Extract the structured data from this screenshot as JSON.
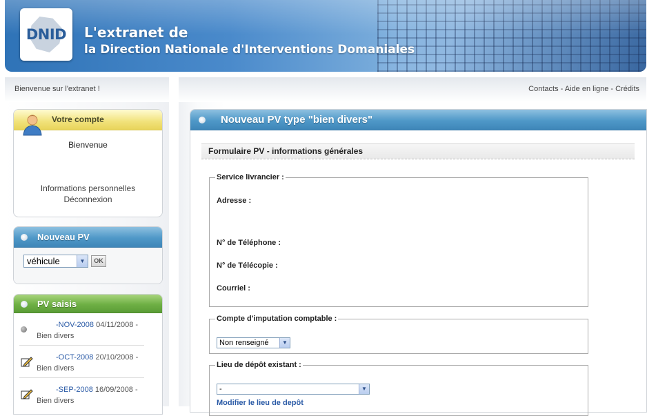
{
  "header": {
    "logo_text": "DNID",
    "title_line1": "L'extranet de",
    "title_line2": "la Direction Nationale d'Interventions Domaniales"
  },
  "topbar": {
    "welcome": "Bienvenue sur l'extranet !",
    "links": [
      "Contacts",
      "Aide en ligne",
      "Crédits"
    ],
    "separator": " - "
  },
  "account": {
    "title": "Votre compte",
    "welcome": "Bienvenue",
    "links": [
      "Informations personnelles",
      "Déconnexion"
    ]
  },
  "new_pv": {
    "title": "Nouveau PV",
    "select_value": "véhicule",
    "ok_label": "OK"
  },
  "pv_saisis": {
    "title": "PV saisis",
    "items": [
      {
        "ref": "-NOV-2008",
        "date": "04/11/2008 -",
        "type": "Bien divers",
        "icon": "gray-dot-icon"
      },
      {
        "ref": "-OCT-2008",
        "date": "20/10/2008 -",
        "type": "Bien divers",
        "icon": "edit-icon"
      },
      {
        "ref": "-SEP-2008",
        "date": "16/09/2008 -",
        "type": "Bien divers",
        "icon": "edit-icon"
      }
    ]
  },
  "main": {
    "title": "Nouveau PV type \"bien divers\"",
    "form_title": "Formulaire PV - informations générales",
    "service": {
      "legend": "Service livrancier :",
      "fields": [
        "Adresse :",
        "N° de Téléphone :",
        "N° de Télécopie :",
        "Courriel :"
      ]
    },
    "compte": {
      "legend": "Compte d'imputation comptable :",
      "select_value": "Non renseigné"
    },
    "lieu": {
      "legend": "Lieu de dépôt existant :",
      "select_value": "-",
      "link": "Modifier le lieu de depôt"
    }
  },
  "colors": {
    "banner_blue": "#2f73b7",
    "header_blue": "#4f98c8",
    "header_green": "#6fb045",
    "account_yellow": "#f1e27a",
    "link_blue": "#2a5aa6"
  }
}
